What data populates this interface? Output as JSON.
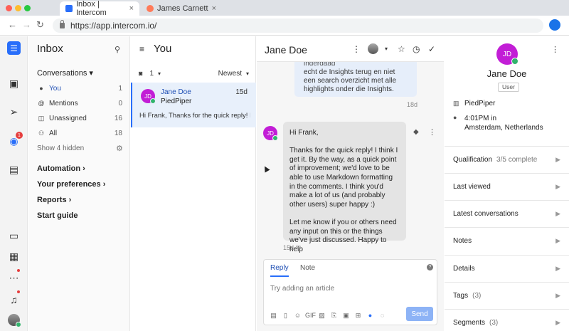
{
  "browser": {
    "tabs": [
      {
        "title": "Inbox | Intercom",
        "favicon_color": "#286efa"
      },
      {
        "title": "James Carnett",
        "favicon_color": "#ff7a59"
      }
    ],
    "url": "https://app.intercom.io/"
  },
  "rail": {
    "logo_icon": "intercom-logo-icon",
    "unread_badge": "1"
  },
  "inbox": {
    "title": "Inbox",
    "conversations_header": "Conversations",
    "items": [
      {
        "label": "You",
        "count": "1",
        "icon": "avatar-icon"
      },
      {
        "label": "Mentions",
        "count": "0",
        "icon": "at-icon"
      },
      {
        "label": "Unassigned",
        "count": "16",
        "icon": "inbox-icon"
      },
      {
        "label": "All",
        "count": "18",
        "icon": "group-icon"
      }
    ],
    "show_hidden": "Show 4 hidden",
    "sections": [
      "Automation",
      "Your preferences",
      "Reports",
      "Start guide"
    ]
  },
  "list": {
    "title": "You",
    "filter_count": "1",
    "sort": "Newest",
    "conversation": {
      "initials": "JD",
      "name": "Jane Doe",
      "time": "15d",
      "company": "PiedPiper",
      "preview": "Hi Frank, Thanks for the quick reply! I ..."
    }
  },
  "main": {
    "title": "Jane Doe",
    "prior_message": "echt de Insights terug en niet een search overzicht met alle highlights onder die Insights.",
    "prior_message_top": "de Insights-sectie krijg je inderdaad",
    "prior_time": "18d",
    "message": {
      "initials": "JD",
      "paragraphs": [
        "Hi Frank,",
        "Thanks for the quick reply! I think I get it. By the way, as a quick point of improvement; we'd love to be able to use Markdown formatting in the comments. I think you'd make a lot of us (and probably other users) super happy :)",
        "Let me know if you or others need any input on this or the things we've just discussed. Happy to help"
      ],
      "time": "15d"
    },
    "composer": {
      "tab_reply": "Reply",
      "tab_note": "Note",
      "placeholder": "Try adding an article",
      "send": "Send",
      "gif": "GIF"
    }
  },
  "user_panel": {
    "initials": "JD",
    "name": "Jane Doe",
    "role": "User",
    "company": "PiedPiper",
    "local_time": "4:01PM in",
    "location": "Amsterdam, Netherlands",
    "sections": [
      {
        "label": "Qualification",
        "sub": "3/5 complete"
      },
      {
        "label": "Last viewed",
        "sub": ""
      },
      {
        "label": "Latest conversations",
        "sub": ""
      },
      {
        "label": "Notes",
        "sub": ""
      },
      {
        "label": "Details",
        "sub": ""
      },
      {
        "label": "Tags",
        "sub": "(3)"
      },
      {
        "label": "Segments",
        "sub": "(3)"
      }
    ]
  },
  "colors": {
    "accent": "#286efa",
    "avatar": "#c21ed6",
    "online": "#32b46c",
    "badge": "#e63e3e"
  }
}
